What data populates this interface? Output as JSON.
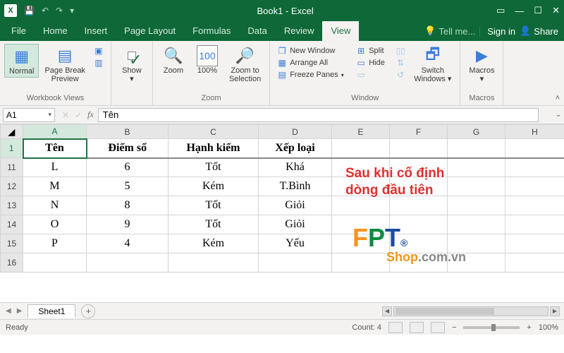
{
  "titlebar": {
    "title": "Book1 - Excel"
  },
  "tabs": {
    "file": "File",
    "home": "Home",
    "insert": "Insert",
    "pagelayout": "Page Layout",
    "formulas": "Formulas",
    "data": "Data",
    "review": "Review",
    "view": "View",
    "tell": "Tell me...",
    "signin": "Sign in",
    "share": "Share"
  },
  "ribbon": {
    "views": {
      "normal": "Normal",
      "pagebreak": "Page Break\nPreview",
      "group": "Workbook Views"
    },
    "show": {
      "label": "Show",
      "group": ""
    },
    "zoom": {
      "zoom": "Zoom",
      "hundred": "100%",
      "tosel": "Zoom to\nSelection",
      "group": "Zoom"
    },
    "window": {
      "new": "New Window",
      "arrange": "Arrange All",
      "freeze": "Freeze Panes",
      "split": "Split",
      "hide": "Hide",
      "switch": "Switch\nWindows",
      "group": "Window"
    },
    "macros": {
      "label": "Macros",
      "group": "Macros"
    }
  },
  "formula": {
    "namebox": "A1",
    "value": "Tên"
  },
  "cols": [
    "A",
    "B",
    "C",
    "D",
    "E",
    "F",
    "G",
    "H"
  ],
  "headerRow": {
    "num": "1",
    "A": "Tên",
    "B": "Điểm số",
    "C": "Hạnh kiểm",
    "D": "Xếp loại"
  },
  "rows": [
    {
      "num": "11",
      "A": "L",
      "B": "6",
      "C": "Tốt",
      "D": "Khá"
    },
    {
      "num": "12",
      "A": "M",
      "B": "5",
      "C": "Kém",
      "D": "T.Bình"
    },
    {
      "num": "13",
      "A": "N",
      "B": "8",
      "C": "Tốt",
      "D": "Giỏi"
    },
    {
      "num": "14",
      "A": "O",
      "B": "9",
      "C": "Tốt",
      "D": "Giỏi"
    },
    {
      "num": "15",
      "A": "P",
      "B": "4",
      "C": "Kém",
      "D": "Yếu"
    },
    {
      "num": "16",
      "A": "",
      "B": "",
      "C": "",
      "D": ""
    }
  ],
  "overlay": {
    "line1": "Sau khi cố định",
    "line2": "dòng đầu tiên"
  },
  "logo": {
    "brand": "FPT",
    "reg": "®",
    "shop": "Shop",
    "com": ".com.vn"
  },
  "sheettab": {
    "name": "Sheet1"
  },
  "status": {
    "ready": "Ready",
    "count": "Count: 4",
    "zoom": "100%"
  }
}
